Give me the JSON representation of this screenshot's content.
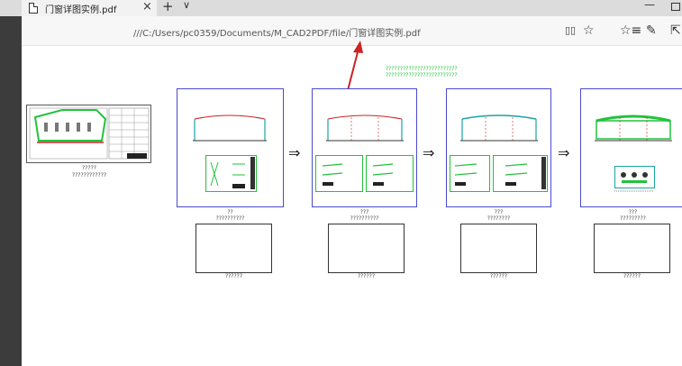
{
  "tab": {
    "title": "门窗详图实例.pdf",
    "close": "×"
  },
  "toolbar": {
    "new_tab": "+",
    "tab_menu": "∨",
    "minimize": "—"
  },
  "address": {
    "url": "///C:/Users/pc0359/Documents/M_CAD2PDF/file/门窗详图实例.pdf"
  },
  "icons": {
    "reading_view": "▯▯",
    "favorite": "☆",
    "favorites_list": "☆≡",
    "notes": "✎",
    "share": "⇱"
  },
  "annotation": {
    "text": [
      "?????????????????????????",
      "?????????????????????????"
    ]
  },
  "thumb_left": {
    "cap1": "?????",
    "cap2": "????????????"
  },
  "stages": [
    {
      "cap1": "??",
      "cap2": "??????????",
      "box_cap": "??????"
    },
    {
      "cap1": "???",
      "cap2": "??????????",
      "box_cap": "??????"
    },
    {
      "cap1": "???",
      "cap2": "????????",
      "box_cap": "??????"
    },
    {
      "cap1": "???",
      "cap2": "?????????",
      "box_cap": "??????"
    }
  ],
  "flow_arrow": "⇒",
  "colors": {
    "frame": "#4a4acd",
    "accent_green": "#23c23c",
    "accent_red": "#cc2222",
    "teal": "#1aa3a3"
  }
}
